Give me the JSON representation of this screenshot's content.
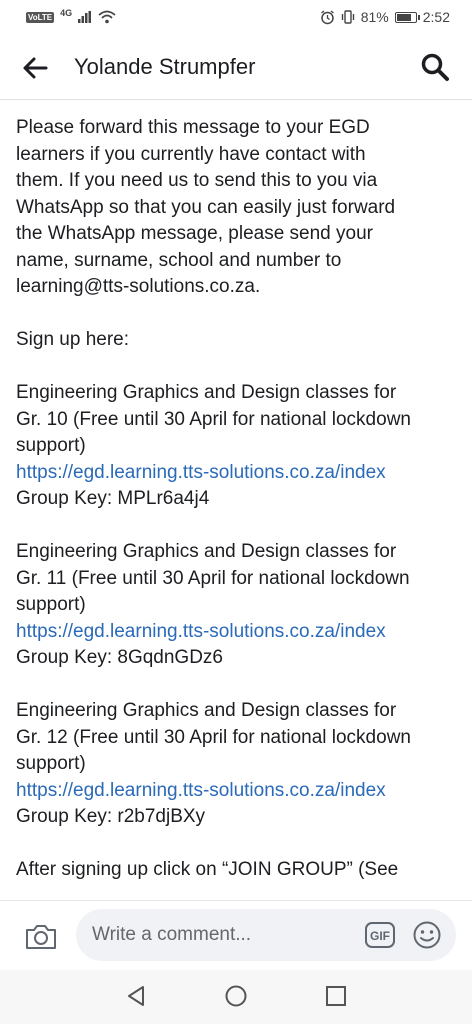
{
  "status_bar": {
    "volte": "VoLTE",
    "network": "4G",
    "battery_percent": "81%",
    "battery_level": 0.81,
    "time": "2:52"
  },
  "header": {
    "title": "Yolande Strumpfer"
  },
  "post": {
    "intro_lines": [
      "Please forward this message to your EGD",
      "learners if you currently have contact with",
      "them. If you need us to send this to you via",
      "WhatsApp so that you can easily just forward",
      "the WhatsApp message, please send your",
      "name, surname, school and number to",
      "learning@tts-solutions.co.za."
    ],
    "sign_up": "Sign up here:",
    "classes": [
      {
        "line1": "Engineering Graphics and Design classes for",
        "line2": "Gr. 10 (Free until 30 April for national lockdown",
        "line3": "support)",
        "link": "https://egd.learning.tts-solutions.co.za/index",
        "group_key": "Group Key: MPLr6a4j4"
      },
      {
        "line1": "Engineering Graphics and Design classes for",
        "line2": "Gr. 11 (Free until 30 April for national lockdown",
        "line3": "support)",
        "link": "https://egd.learning.tts-solutions.co.za/index",
        "group_key": "Group Key: 8GqdnGDz6"
      },
      {
        "line1": "Engineering Graphics and Design classes for",
        "line2": "Gr. 12 (Free until 30 April for national lockdown",
        "line3": "support)",
        "link": "https://egd.learning.tts-solutions.co.za/index",
        "group_key": "Group Key: r2b7djBXy"
      }
    ],
    "after_text": "After signing up click on “JOIN GROUP” (See"
  },
  "comment_bar": {
    "placeholder": "Write a comment...",
    "gif_label": "GIF"
  },
  "colors": {
    "link": "#2a6ab8",
    "text": "#1c1e21",
    "input_bg": "#f0f2f5"
  }
}
